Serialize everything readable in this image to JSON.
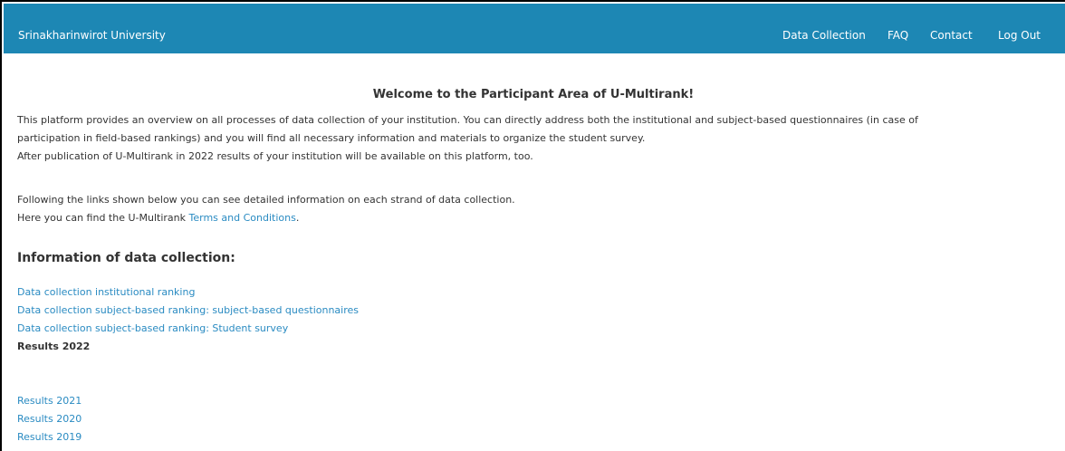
{
  "header": {
    "brand": "Srinakharinwirot University",
    "nav": {
      "data_collection": "Data Collection",
      "faq": "FAQ",
      "contact": "Contact",
      "logout": "Log Out"
    },
    "bar_color": "#1d87b4"
  },
  "main": {
    "welcome": "Welcome to the Participant Area of U-Multirank!",
    "para1": "This platform provides an overview on all processes of data collection of your institution. You can directly address both the institutional and subject-based questionnaires (in case of",
    "para2": "participation in field-based rankings) and you will find all necessary information and materials to organize the student survey.",
    "para3": "After publication of U-Multirank in 2022 results of your institution will be available on this platform, too.",
    "para4": "Following the links shown below you can see detailed information on each strand of data collection.",
    "para5_prefix": "Here you can find the U-Multirank ",
    "terms_link": "Terms and Conditions",
    "para5_suffix": ".",
    "section_title": "Information of data collection:",
    "links": {
      "institutional": "Data collection institutional ranking",
      "subject_questionnaires": "Data collection subject-based ranking: subject-based questionnaires",
      "student_survey": "Data collection subject-based ranking: Student survey",
      "results_2022": "Results 2022",
      "results_2021": "Results 2021",
      "results_2020": "Results 2020",
      "results_2019": "Results 2019"
    },
    "link_color": "#2a8bc2"
  }
}
